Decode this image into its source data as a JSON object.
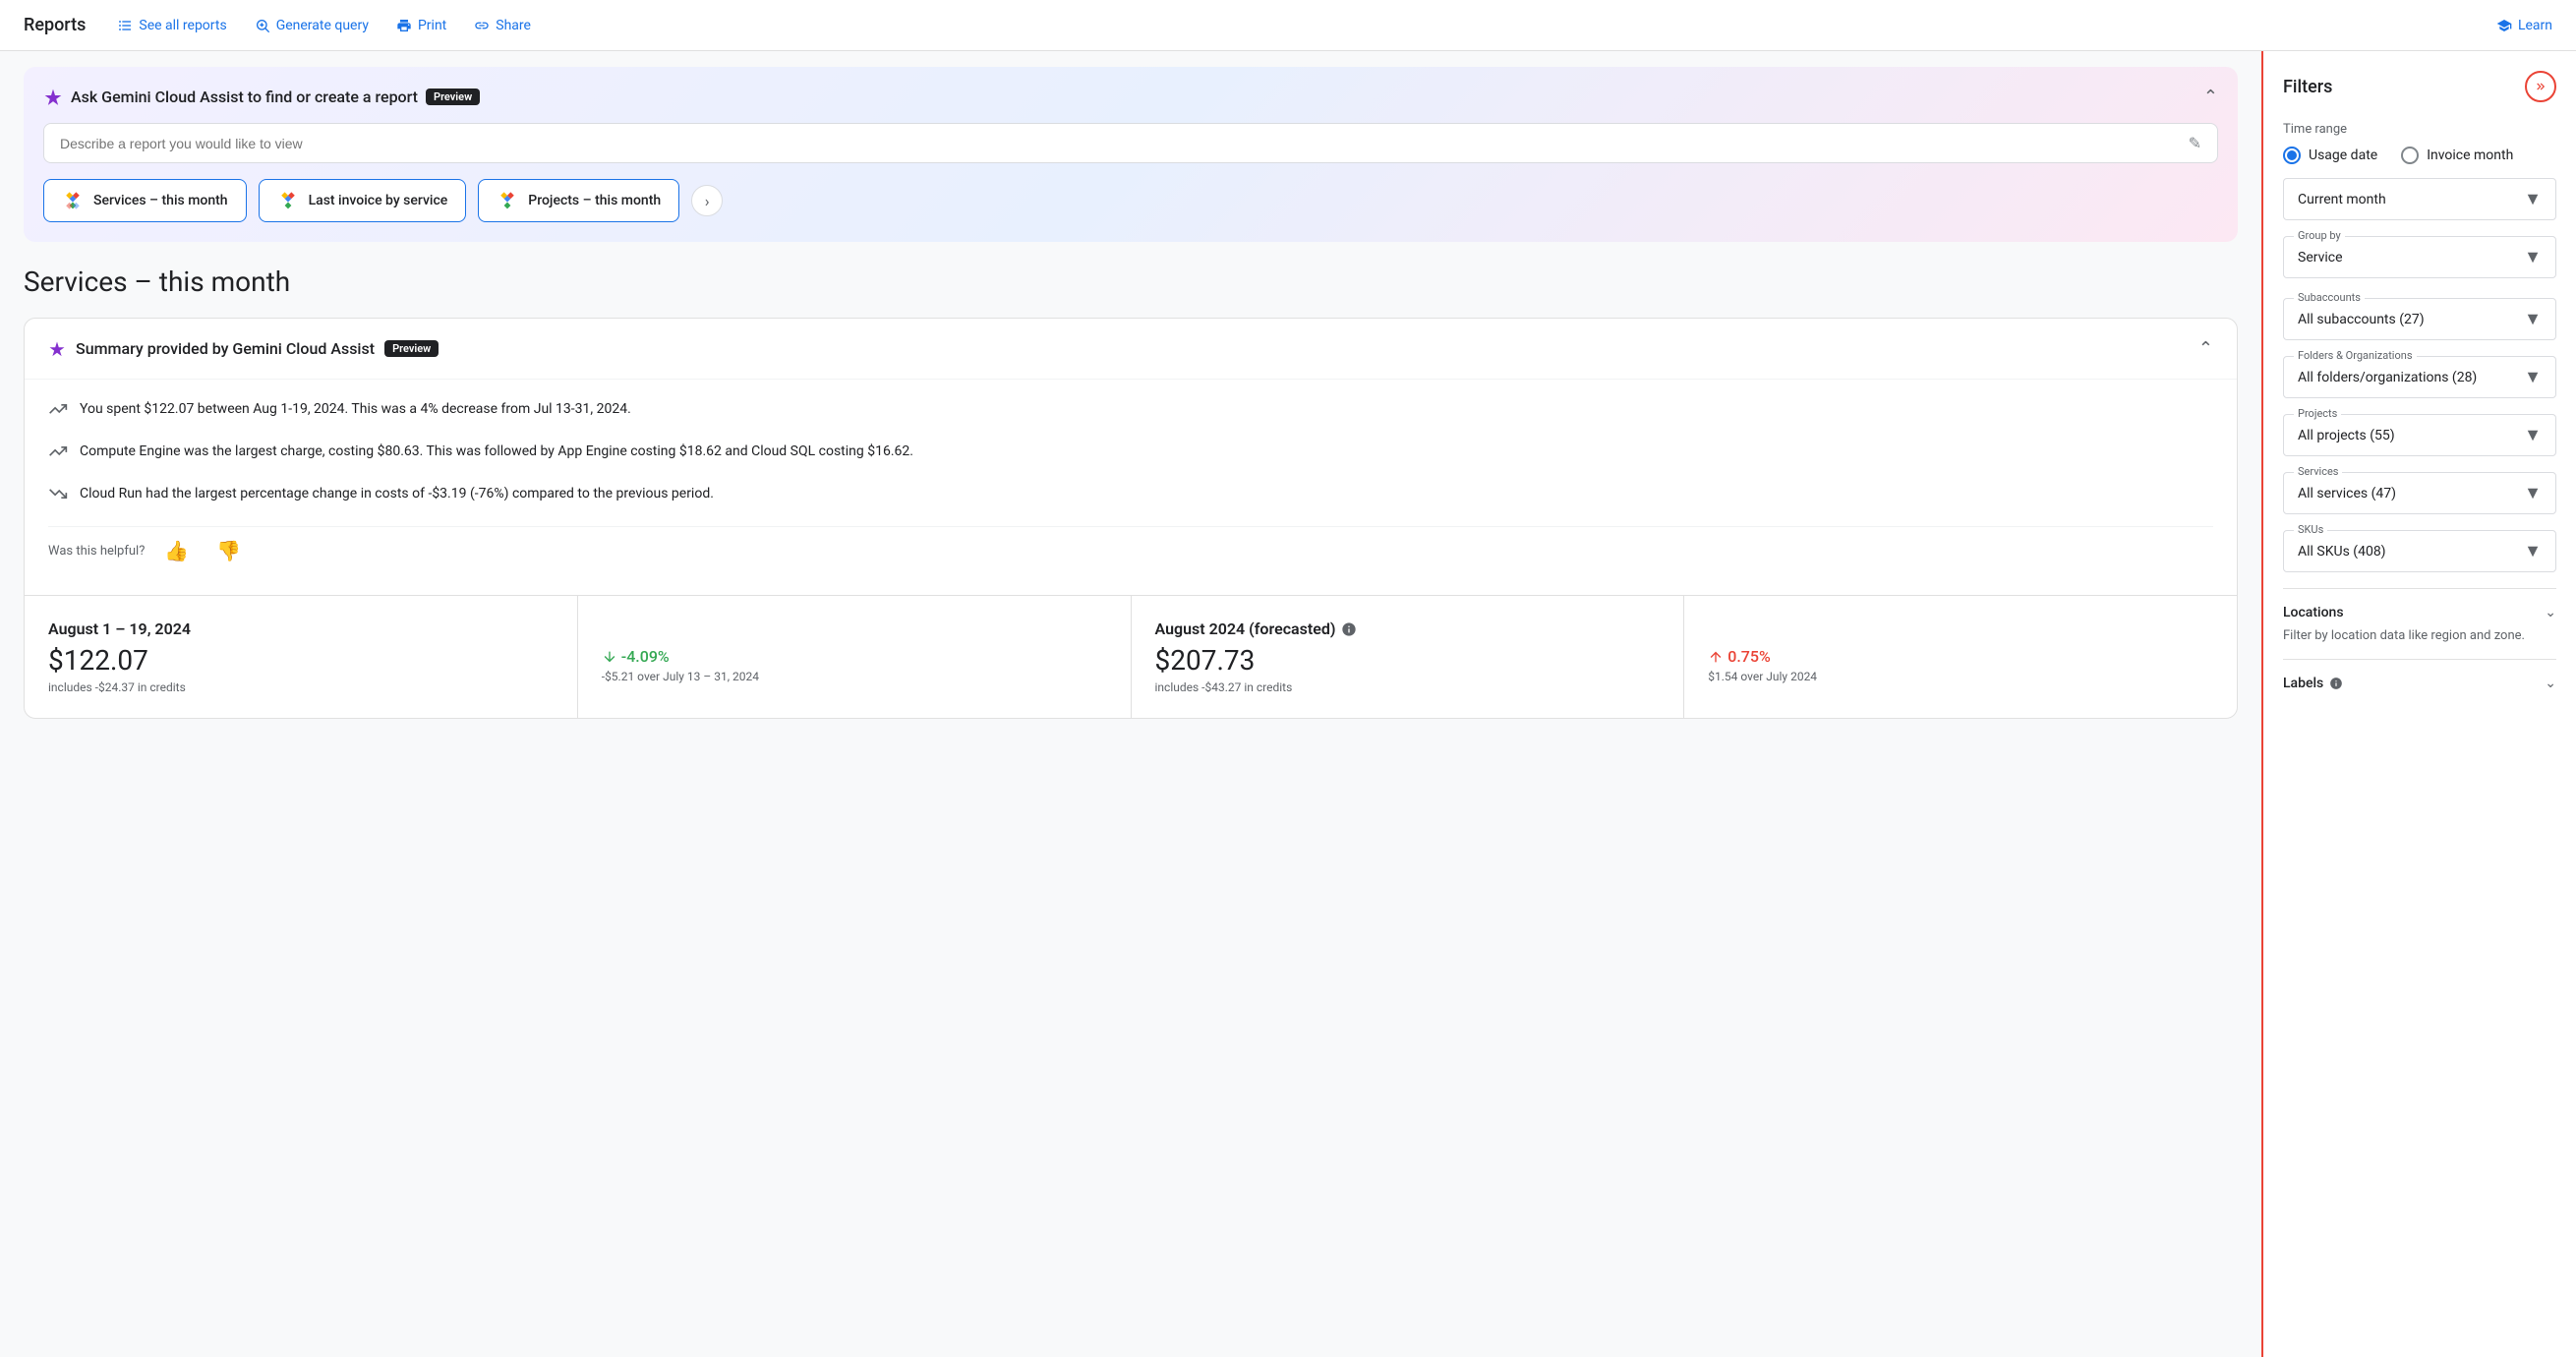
{
  "nav": {
    "title": "Reports",
    "links": [
      {
        "id": "see-all-reports",
        "label": "See all reports",
        "icon": "list-icon"
      },
      {
        "id": "generate-query",
        "label": "Generate query",
        "icon": "query-icon"
      },
      {
        "id": "print",
        "label": "Print",
        "icon": "print-icon"
      },
      {
        "id": "share",
        "label": "Share",
        "icon": "share-icon"
      },
      {
        "id": "learn",
        "label": "Learn",
        "icon": "learn-icon"
      }
    ]
  },
  "gemini": {
    "title": "Ask Gemini Cloud Assist to find or create a report",
    "preview_badge": "Preview",
    "input_placeholder": "Describe a report you would like to view",
    "chips": [
      {
        "label": "Services – this month"
      },
      {
        "label": "Last invoice by service"
      },
      {
        "label": "Projects – this month"
      }
    ]
  },
  "page_title": "Services – this month",
  "summary": {
    "title": "Summary provided by Gemini Cloud Assist",
    "preview_badge": "Preview",
    "items": [
      {
        "text": "You spent $122.07 between Aug 1-19, 2024. This was a 4% decrease from Jul 13-31, 2024."
      },
      {
        "text": "Compute Engine was the largest charge, costing $80.63. This was followed by App Engine costing $18.62 and Cloud SQL costing $16.62."
      },
      {
        "text": "Cloud Run had the largest percentage change in costs of -$3.19 (-76%) compared to the previous period."
      }
    ],
    "helpful_label": "Was this helpful?"
  },
  "stats": {
    "current": {
      "date_label": "August 1 – 19, 2024",
      "amount": "$122.07",
      "sub": "includes -$24.37 in credits",
      "change": "-4.09%",
      "change_direction": "down",
      "change_sub": "-$5.21 over July 13 – 31, 2024"
    },
    "forecast": {
      "date_label": "August 2024 (forecasted)",
      "amount": "$207.73",
      "sub": "includes -$43.27 in credits",
      "change": "0.75%",
      "change_direction": "up",
      "change_sub": "$1.54 over July 2024"
    }
  },
  "filters": {
    "title": "Filters",
    "time_range_label": "Time range",
    "radio_options": [
      {
        "label": "Usage date",
        "selected": true
      },
      {
        "label": "Invoice month",
        "selected": false
      }
    ],
    "current_month": {
      "label": "Current month",
      "field_label": ""
    },
    "group_by": {
      "label": "Group by",
      "value": "Service"
    },
    "subaccounts": {
      "label": "Subaccounts",
      "value": "All subaccounts (27)"
    },
    "folders_orgs": {
      "label": "Folders & Organizations",
      "value": "All folders/organizations (28)"
    },
    "projects": {
      "label": "Projects",
      "value": "All projects (55)"
    },
    "services": {
      "label": "Services",
      "value": "All services (47)"
    },
    "skus": {
      "label": "SKUs",
      "value": "All SKUs (408)"
    },
    "locations": {
      "label": "Locations",
      "description": "Filter by location data like region and zone."
    },
    "labels": {
      "label": "Labels"
    }
  }
}
